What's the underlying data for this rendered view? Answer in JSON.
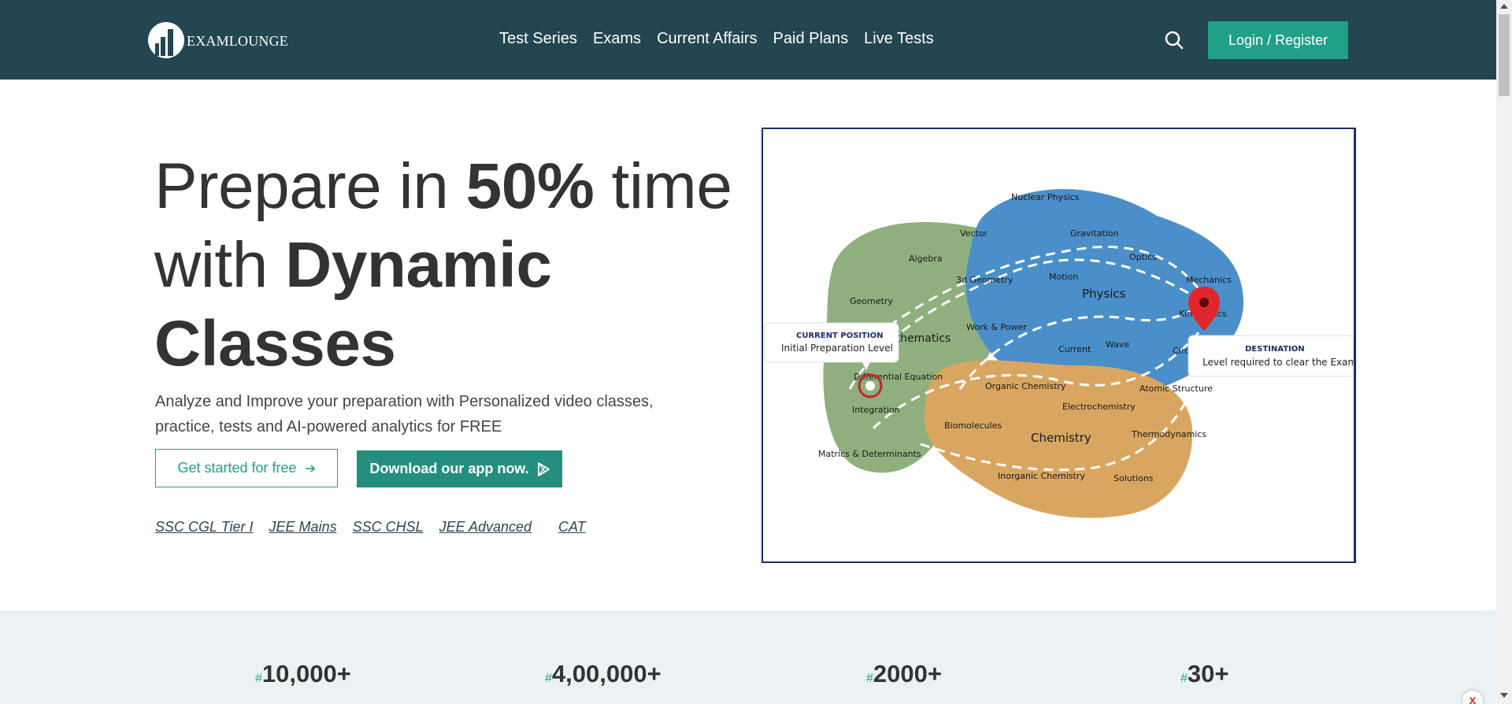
{
  "header": {
    "logo_text": "EXAMLOUNGE",
    "nav": [
      "Test Series",
      "Exams",
      "Current Affairs",
      "Paid Plans",
      "Live Tests"
    ],
    "login_label": "Login / Register",
    "bg_color": "#244552",
    "accent_color": "#21a089"
  },
  "hero": {
    "title_line1_a": "Prepare in ",
    "title_line1_b": "50%",
    "title_line1_c": " time",
    "title_line2_a": "with ",
    "title_line2_b": "Dynamic",
    "title_line3": "Classes",
    "subtitle": "Analyze and Improve your preparation with Personalized video classes, practice, tests and AI-powered analytics for FREE",
    "cta_primary": "Get started for free",
    "cta_secondary": "Download our app now.",
    "exam_links": [
      "SSC CGL Tier I",
      "JEE Mains",
      "SSC CHSL",
      "JEE Advanced",
      "CAT"
    ]
  },
  "map": {
    "topics": [
      "Nuclear Physics",
      "Vector",
      "Gravitation",
      "Algebra",
      "Optics",
      "3d Geometry",
      "Motion",
      "Mechanics",
      "Physics",
      "Geometry",
      "Kinematics",
      "Work & Power",
      "Mathematics",
      "Wave",
      "Current",
      "Differential Equation",
      "Circuits",
      "Organic Chemistry",
      "Atomic Structure",
      "Integration",
      "Electrochemistry",
      "Biomolecules",
      "Thermodynamics",
      "Chemistry",
      "Matrics & Determinants",
      "Inorganic Chemistry",
      "Solutions"
    ],
    "current_title": "CURRENT POSITION",
    "current_text": "Initial Preparation Level",
    "destination_title": "DESTINATION",
    "destination_text": "Level required to clear the Exam",
    "colors": {
      "math": "#8fb07e",
      "physics": "#4a8fc9",
      "chemistry": "#d9a662"
    }
  },
  "stats": [
    {
      "hash": "#",
      "value": "10,000+"
    },
    {
      "hash": "#",
      "value": "4,00,000+"
    },
    {
      "hash": "#",
      "value": "2000+"
    },
    {
      "hash": "#",
      "value": "30+"
    }
  ],
  "close_label": "x"
}
